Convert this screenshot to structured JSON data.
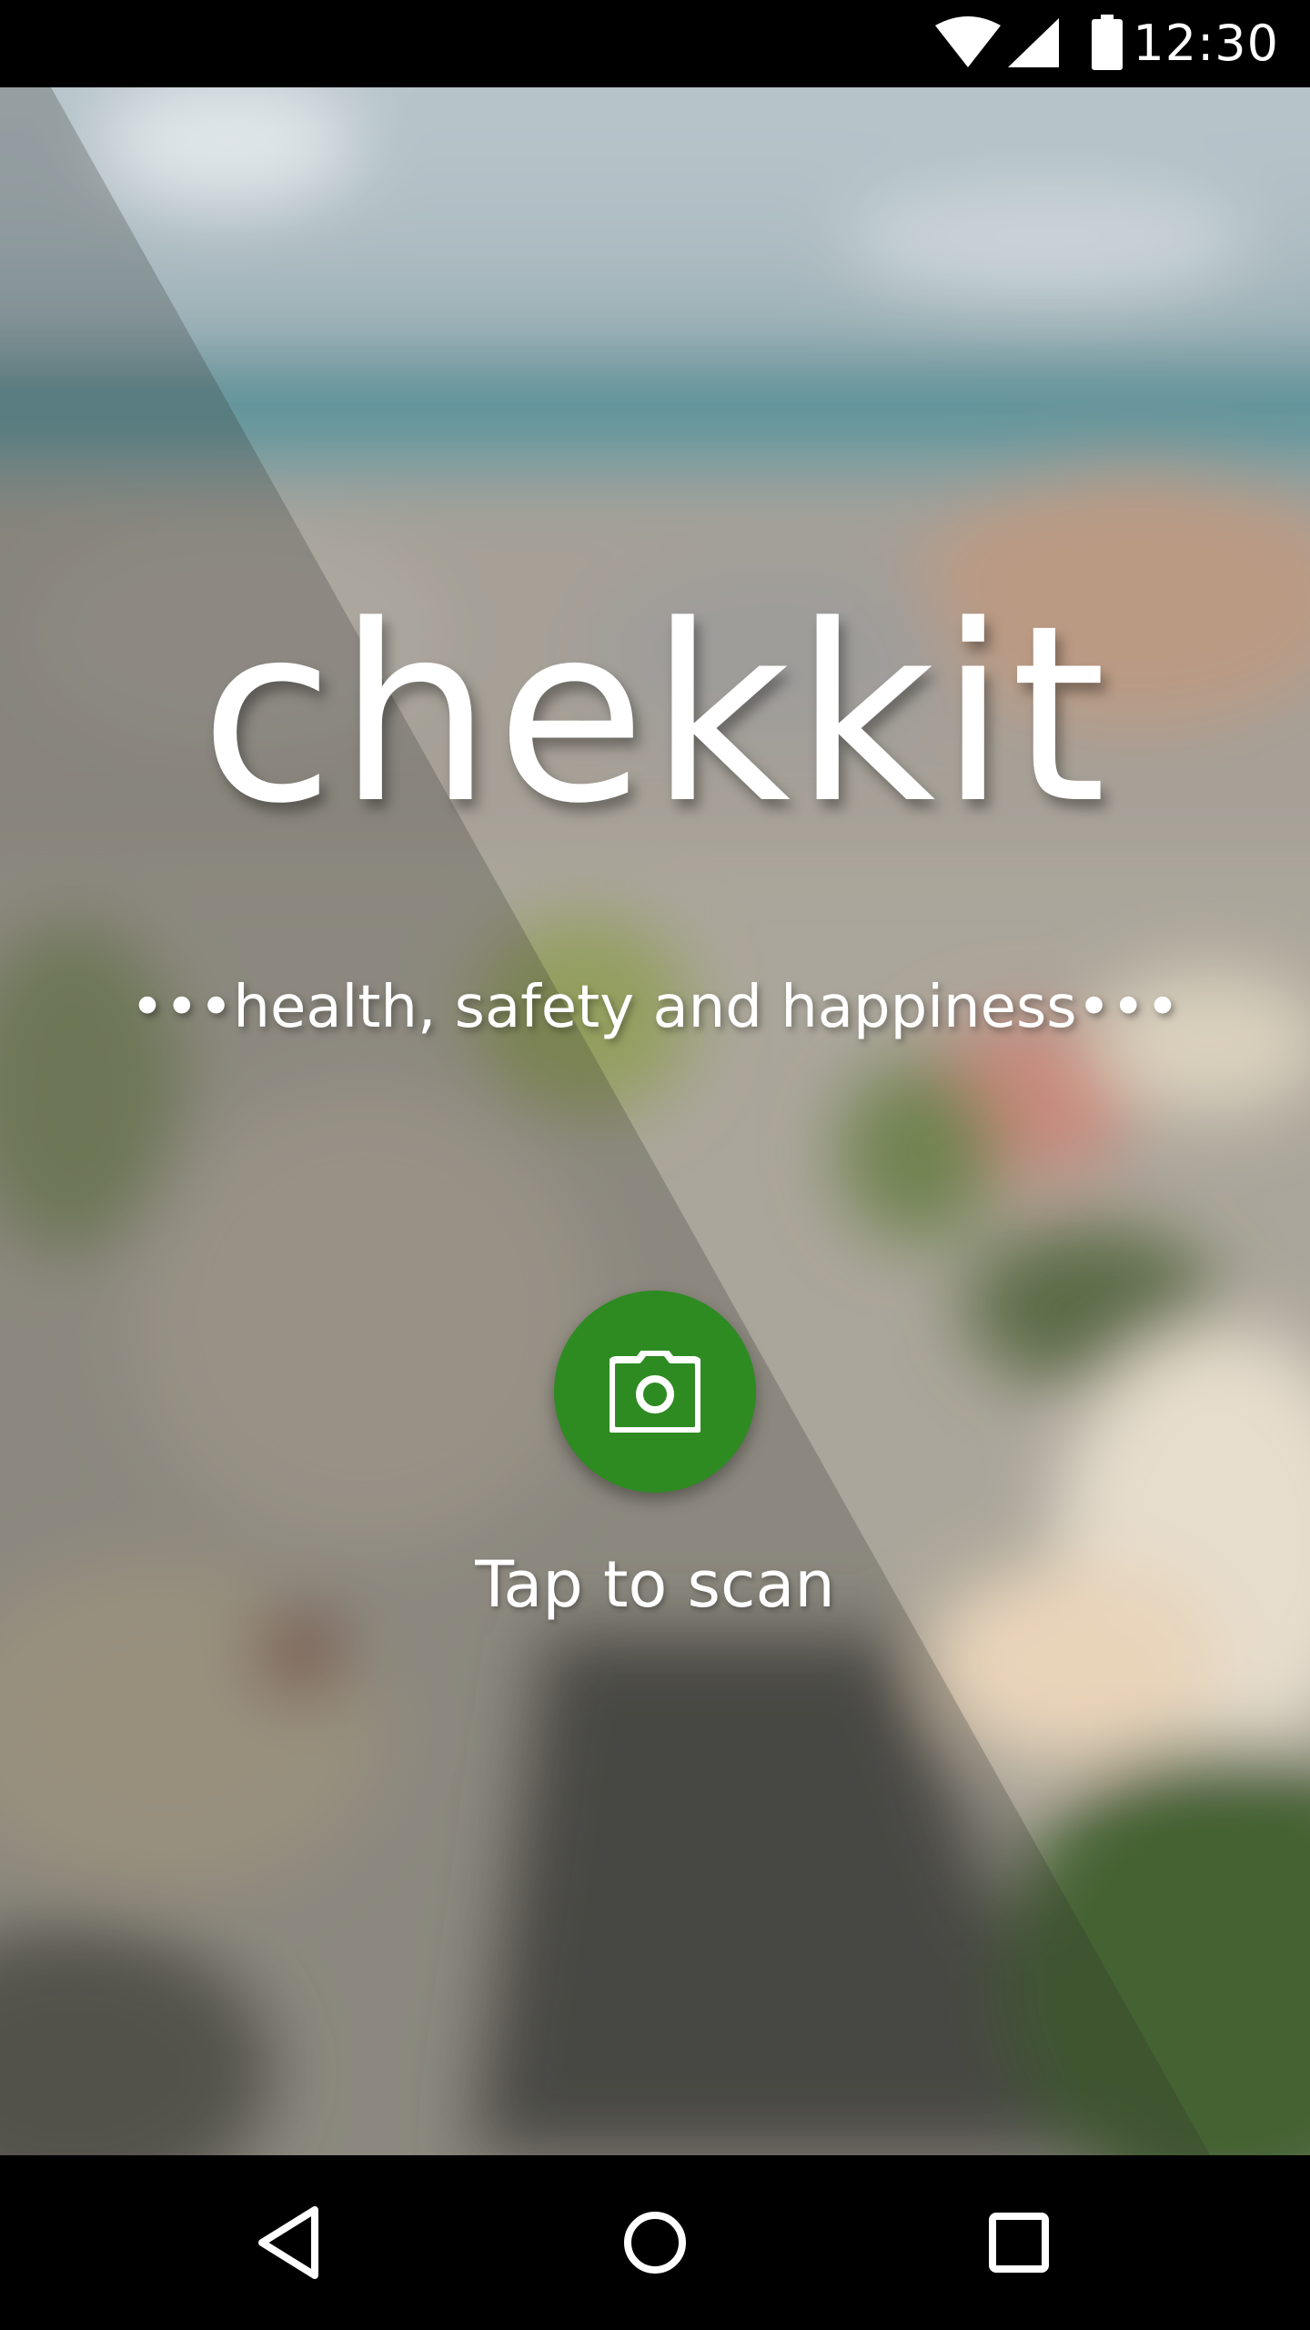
{
  "status_bar": {
    "time": "12:30",
    "icons": [
      "wifi-icon",
      "cell-signal-icon",
      "battery-icon"
    ]
  },
  "app": {
    "logo_text": "chekkit",
    "tagline": "•••health, safety and happiness•••"
  },
  "scan": {
    "icon": "camera-icon",
    "label": "Tap to scan",
    "button_color": "#2e8b22"
  },
  "nav_bar": {
    "buttons": [
      "back-icon",
      "home-icon",
      "recents-icon"
    ]
  },
  "colors": {
    "accent": "#2e8b22",
    "text": "#ffffff",
    "bars": "#000000"
  }
}
